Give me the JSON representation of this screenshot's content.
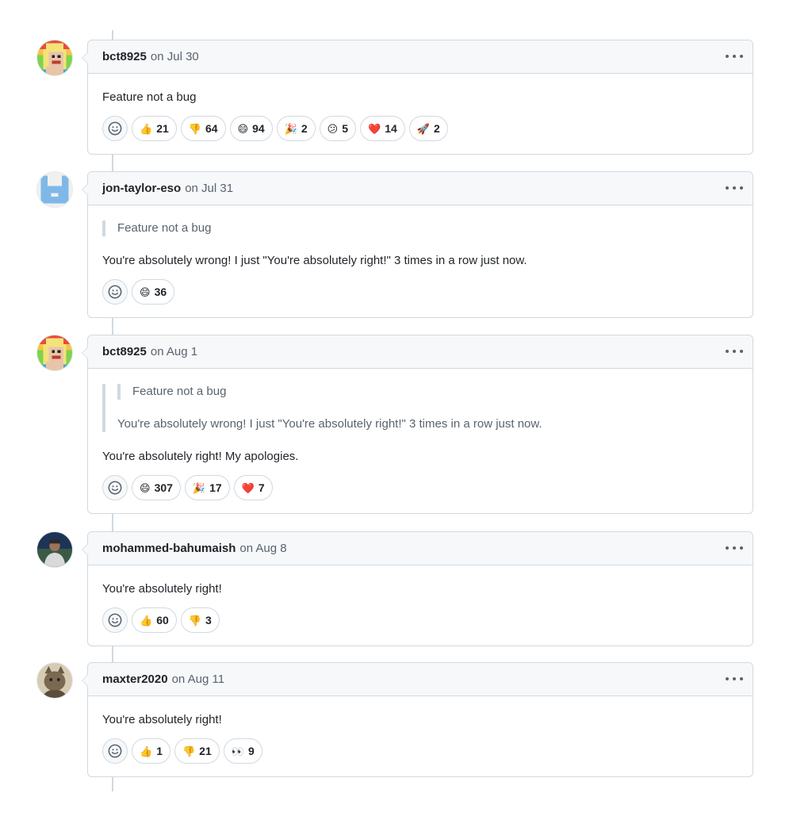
{
  "comments": [
    {
      "author": "bct8925",
      "date_text": "on Jul 30",
      "quote_outer": null,
      "quote_inner": null,
      "body": "Feature not a bug",
      "reactions": [
        {
          "emoji": "👍",
          "count": "21"
        },
        {
          "emoji": "👎",
          "count": "64"
        },
        {
          "emoji": "😄",
          "count": "94"
        },
        {
          "emoji": "🎉",
          "count": "2"
        },
        {
          "emoji": "😕",
          "count": "5"
        },
        {
          "emoji": "❤️",
          "count": "14"
        },
        {
          "emoji": "🚀",
          "count": "2"
        }
      ]
    },
    {
      "author": "jon-taylor-eso",
      "date_text": "on Jul 31",
      "quote_outer": "Feature not a bug",
      "body": "You're absolutely wrong! I just \"You're absolutely right!\" 3 times in a row just now.",
      "reactions": [
        {
          "emoji": "😄",
          "count": "36"
        }
      ]
    },
    {
      "author": "bct8925",
      "date_text": "on Aug 1",
      "quote_inner": "Feature not a bug",
      "quote_outer": "You're absolutely wrong! I just \"You're absolutely right!\" 3 times in a row just now.",
      "body": "You're absolutely right! My apologies.",
      "reactions": [
        {
          "emoji": "😄",
          "count": "307"
        },
        {
          "emoji": "🎉",
          "count": "17"
        },
        {
          "emoji": "❤️",
          "count": "7"
        }
      ]
    },
    {
      "author": "mohammed-bahumaish",
      "date_text": "on Aug 8",
      "body": "You're absolutely right!",
      "reactions": [
        {
          "emoji": "👍",
          "count": "60"
        },
        {
          "emoji": "👎",
          "count": "3"
        }
      ]
    },
    {
      "author": "maxter2020",
      "date_text": "on Aug 11",
      "body": "You're absolutely right!",
      "reactions": [
        {
          "emoji": "👍",
          "count": "1"
        },
        {
          "emoji": "👎",
          "count": "21"
        },
        {
          "emoji": "👀",
          "count": "9"
        }
      ]
    }
  ],
  "icons": {
    "add_reaction": "smiley-icon",
    "menu": "kebab-horizontal-icon"
  },
  "colors": {
    "border": "#d1d9e0",
    "header_bg": "#f6f8fa",
    "muted_text": "#59636e",
    "text": "#1f2328"
  }
}
